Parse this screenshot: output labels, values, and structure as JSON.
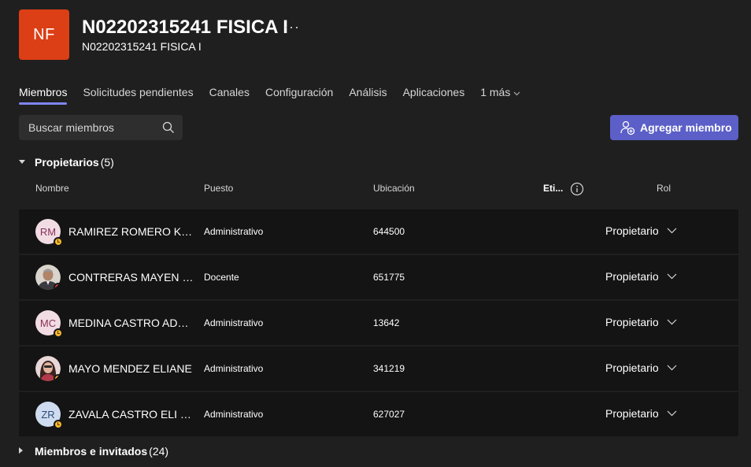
{
  "team": {
    "initials": "NF",
    "avatar_color": "#dc3e15",
    "title": "N02202315241 FISICA I",
    "subtitle": "N02202315241 FISICA I",
    "more_label": "···"
  },
  "tabs": [
    {
      "label": "Miembros",
      "active": true
    },
    {
      "label": "Solicitudes pendientes"
    },
    {
      "label": "Canales"
    },
    {
      "label": "Configuración"
    },
    {
      "label": "Análisis"
    },
    {
      "label": "Aplicaciones"
    },
    {
      "label": "1 más"
    }
  ],
  "search": {
    "placeholder": "Buscar miembros",
    "value": "",
    "icon": "search-icon"
  },
  "add_button": {
    "label": "Agregar miembro",
    "icon": "add-person-icon",
    "color": "#5b5fc7"
  },
  "owners_section": {
    "label": "Propietarios",
    "count": "(5)",
    "expanded": true
  },
  "columns": {
    "name": "Nombre",
    "title": "Puesto",
    "location": "Ubicación",
    "tags": "Eti...",
    "role": "Rol"
  },
  "owners": [
    {
      "initials": "RM",
      "name": "RAMIREZ ROMERO KARINA",
      "title": "Administrativo",
      "location": "644500",
      "role": "Propietario",
      "presence": "away",
      "avatar": "initials"
    },
    {
      "initials": "",
      "name": "CONTRERAS MAYEN RAFAEL",
      "title": "Docente",
      "location": "651775",
      "role": "Propietario",
      "presence": "busy",
      "avatar": "photo"
    },
    {
      "initials": "MC",
      "name": "MEDINA CASTRO ADANELY",
      "title": "Administrativo",
      "location": "13642",
      "role": "Propietario",
      "presence": "away",
      "avatar": "initials"
    },
    {
      "initials": "",
      "name": "MAYO MENDEZ ELIANE",
      "title": "Administrativo",
      "location": "341219",
      "role": "Propietario",
      "presence": "away",
      "avatar": "photo"
    },
    {
      "initials": "ZR",
      "name": "ZAVALA CASTRO ELI RAMON",
      "title": "Administrativo",
      "location": "627027",
      "role": "Propietario",
      "presence": "away",
      "avatar": "initials"
    }
  ],
  "members_section": {
    "label": "Miembros e invitados",
    "count": "(24)",
    "expanded": false
  }
}
